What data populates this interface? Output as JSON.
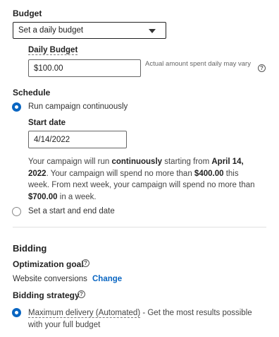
{
  "budget": {
    "heading": "Budget",
    "select_value": "Set a daily budget",
    "daily_label": "Daily Budget",
    "daily_value": "$100.00",
    "hint": "Actual amount spent daily may vary"
  },
  "schedule": {
    "heading": "Schedule",
    "option_continuous": "Run campaign continuously",
    "start_label": "Start date",
    "start_value": "4/14/2022",
    "summary": {
      "p1": "Your campaign will run ",
      "b1": "continuously",
      "p2": " starting from ",
      "b2": "April 14, 2022",
      "p3": ". Your campaign will spend no more than ",
      "b3": "$400.00",
      "p4": " this week. From next week, your campaign will spend no more than ",
      "b4": "$700.00",
      "p5": " in a week."
    },
    "option_range": "Set a start and end date"
  },
  "bidding": {
    "heading": "Bidding",
    "goal_label": "Optimization goal",
    "goal_value": "Website conversions",
    "change_label": "Change",
    "strategy_label": "Bidding strategy",
    "strategy_option": "Maximum delivery (Automated)",
    "strategy_desc": " - Get the most results possible with your full budget"
  },
  "colors": {
    "accent": "#0a66c2"
  },
  "icons": {
    "help": "question-circle-icon",
    "dropdown": "caret-down-icon"
  }
}
